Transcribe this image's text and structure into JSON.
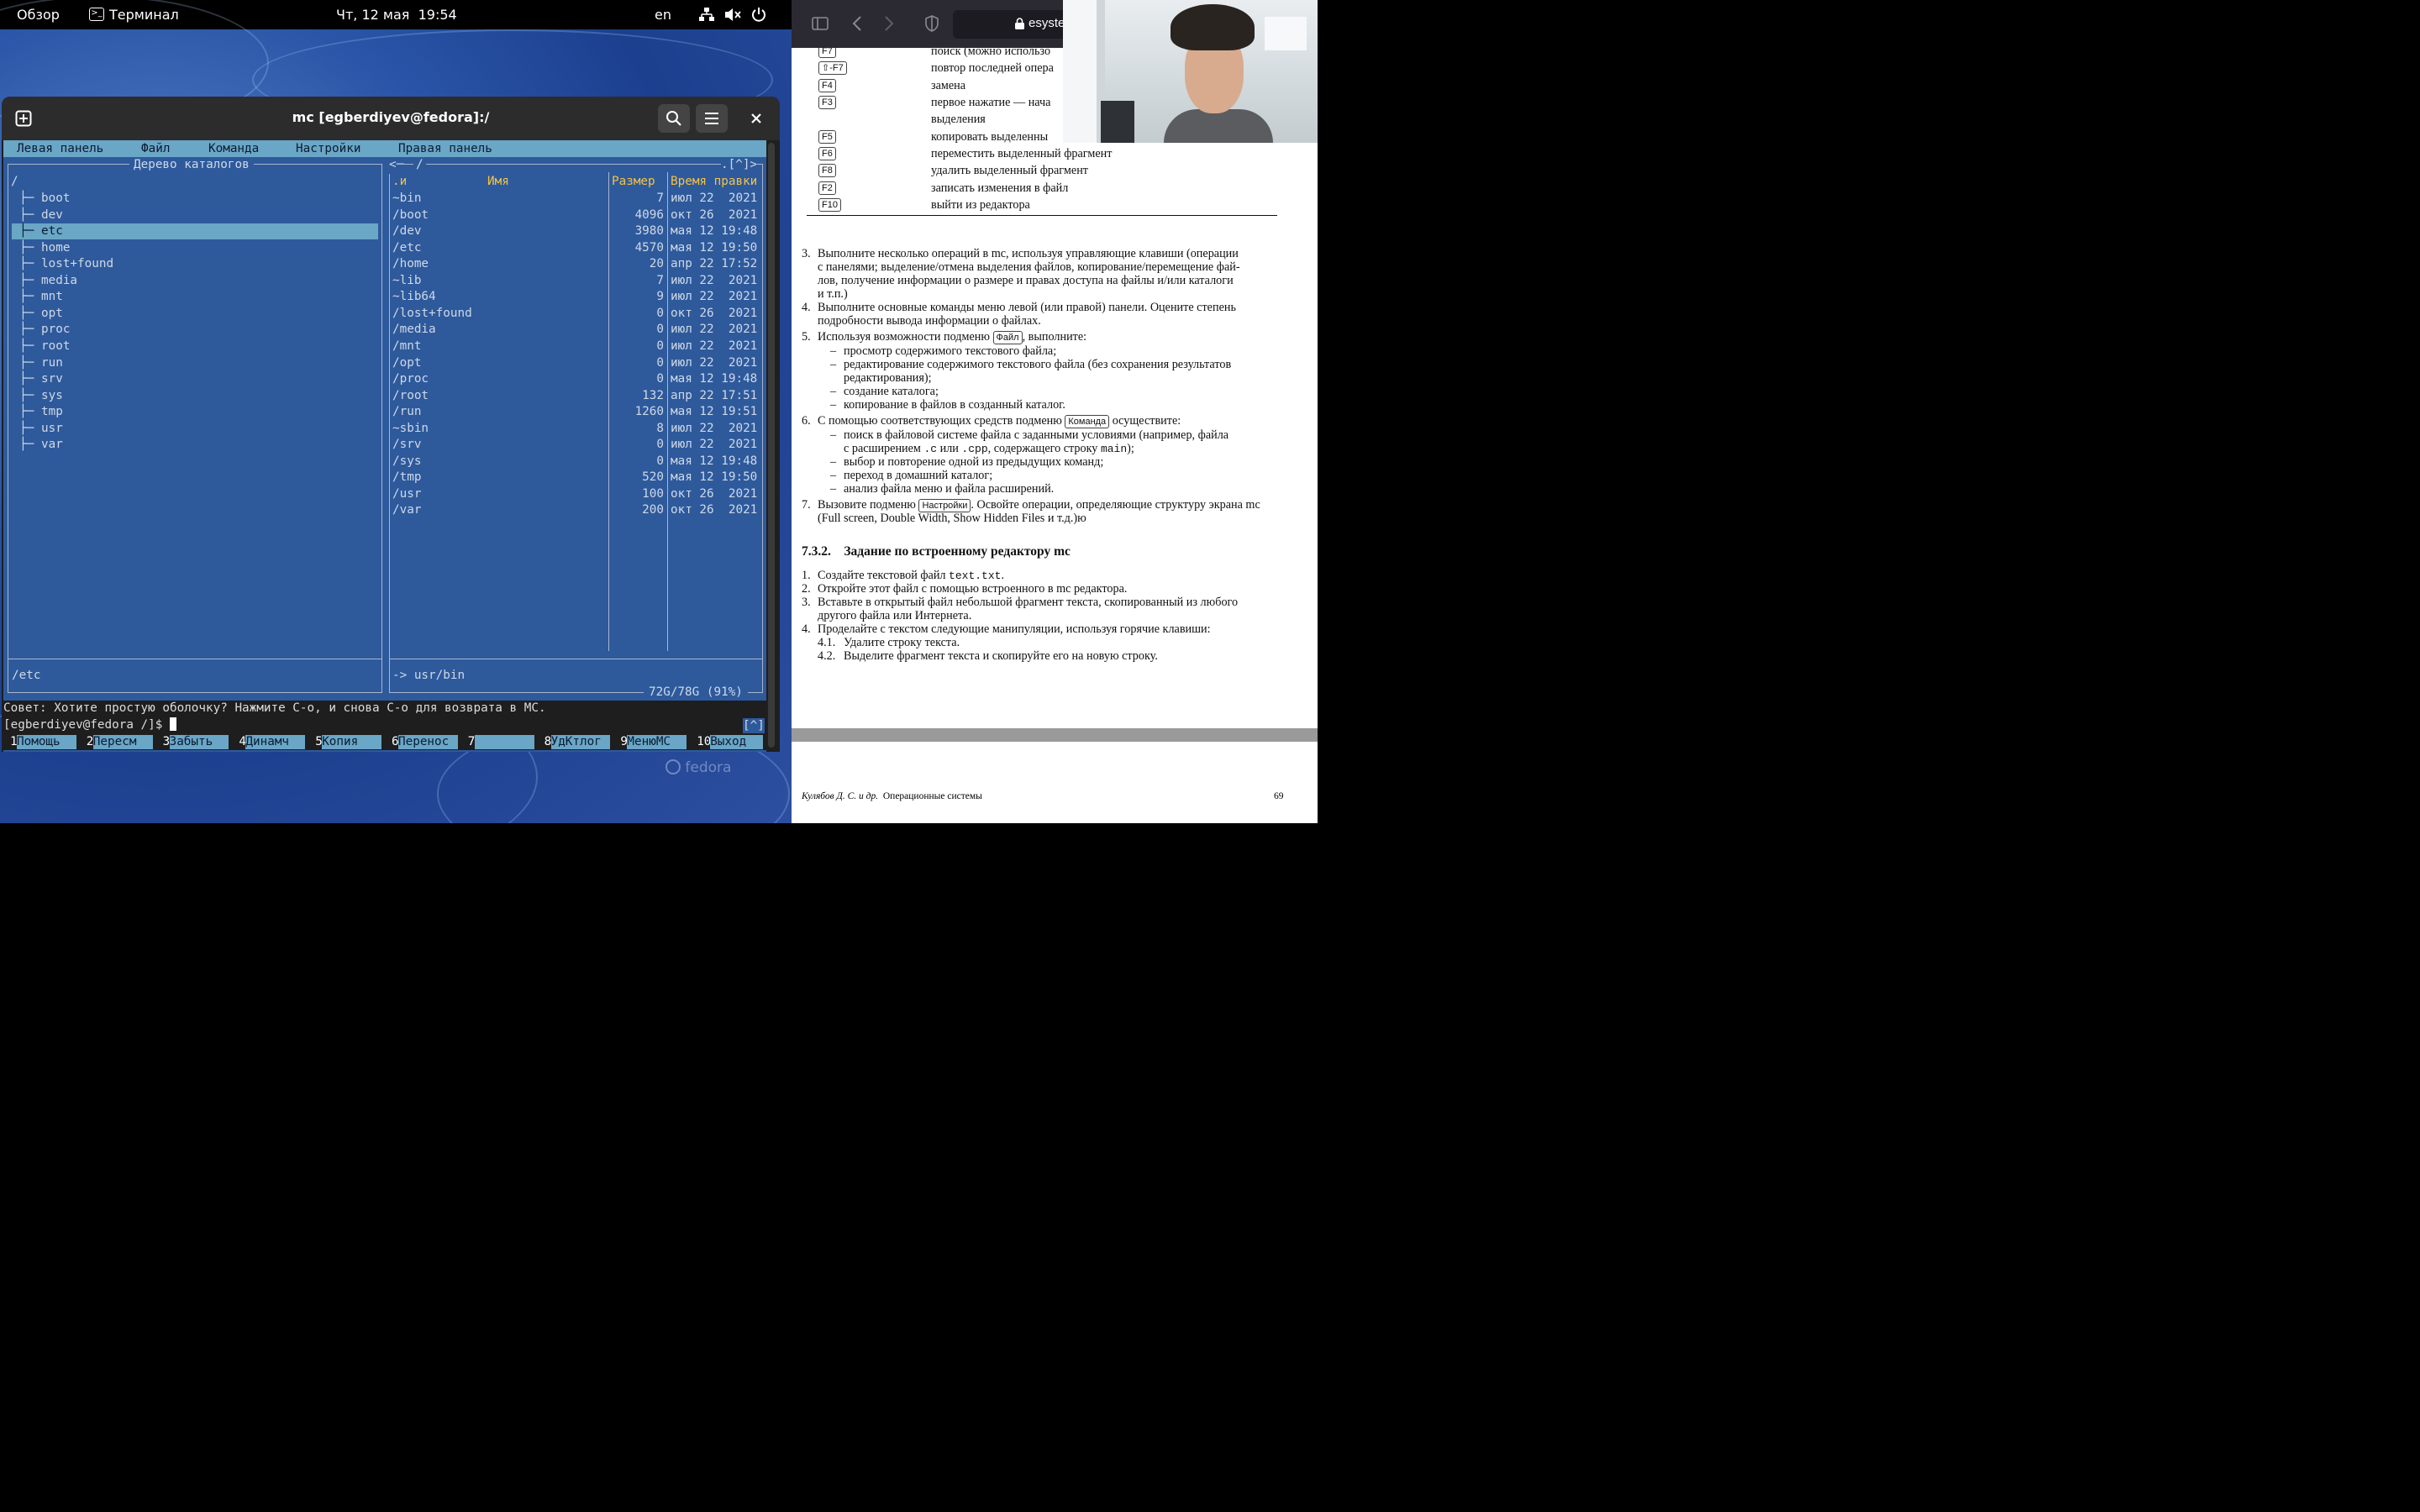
{
  "topbar": {
    "overview": "Обзор",
    "app": "Терминал",
    "clock": "Чт, 12 мая  19:54",
    "lang": "en"
  },
  "window": {
    "title": "mc [egberdiyev@fedora]:/"
  },
  "mc": {
    "menu": [
      "Левая панель",
      "Файл",
      "Команда",
      "Настройки",
      "Правая панель"
    ],
    "left": {
      "title": "Дерево каталогов",
      "root": "/",
      "tree": [
        "boot",
        "dev",
        "etc",
        "home",
        "lost+found",
        "media",
        "mnt",
        "opt",
        "proc",
        "root",
        "run",
        "srv",
        "sys",
        "tmp",
        "usr",
        "var"
      ],
      "selected": "etc",
      "status": "/etc"
    },
    "right": {
      "path": "/",
      "corner": ".[^]>",
      "head": {
        "n": ".и",
        "name": "Имя",
        "size": "Размер",
        "time": "Время правки"
      },
      "rows": [
        {
          "name": "~bin",
          "size": "7",
          "time": "июл 22  2021"
        },
        {
          "name": "/boot",
          "size": "4096",
          "time": "окт 26  2021"
        },
        {
          "name": "/dev",
          "size": "3980",
          "time": "мая 12 19:48"
        },
        {
          "name": "/etc",
          "size": "4570",
          "time": "мая 12 19:50"
        },
        {
          "name": "/home",
          "size": "20",
          "time": "апр 22 17:52"
        },
        {
          "name": "~lib",
          "size": "7",
          "time": "июл 22  2021"
        },
        {
          "name": "~lib64",
          "size": "9",
          "time": "июл 22  2021"
        },
        {
          "name": "/lost+found",
          "size": "0",
          "time": "окт 26  2021"
        },
        {
          "name": "/media",
          "size": "0",
          "time": "июл 22  2021"
        },
        {
          "name": "/mnt",
          "size": "0",
          "time": "июл 22  2021"
        },
        {
          "name": "/opt",
          "size": "0",
          "time": "июл 22  2021"
        },
        {
          "name": "/proc",
          "size": "0",
          "time": "мая 12 19:48"
        },
        {
          "name": "/root",
          "size": "132",
          "time": "апр 22 17:51"
        },
        {
          "name": "/run",
          "size": "1260",
          "time": "мая 12 19:51"
        },
        {
          "name": "~sbin",
          "size": "8",
          "time": "июл 22  2021"
        },
        {
          "name": "/srv",
          "size": "0",
          "time": "июл 22  2021"
        },
        {
          "name": "/sys",
          "size": "0",
          "time": "мая 12 19:48"
        },
        {
          "name": "/tmp",
          "size": "520",
          "time": "мая 12 19:50"
        },
        {
          "name": "/usr",
          "size": "100",
          "time": "окт 26  2021"
        },
        {
          "name": "/var",
          "size": "200",
          "time": "окт 26  2021"
        }
      ],
      "status": "-> usr/bin",
      "disk": "72G/78G (91%)"
    },
    "hint": "Совет: Хотите простую оболочку? Нажмите C-o, и снова C-o для возврата в MC.",
    "prompt": "[egberdiyev@fedora /]$",
    "prompt_tag": "[^]",
    "fkeys": [
      {
        "n": "1",
        "l": "Помощь"
      },
      {
        "n": "2",
        "l": "Пересм"
      },
      {
        "n": "3",
        "l": "Забыть"
      },
      {
        "n": "4",
        "l": "Динамч"
      },
      {
        "n": "5",
        "l": "Копия"
      },
      {
        "n": "6",
        "l": "Перенос"
      },
      {
        "n": "7",
        "l": ""
      },
      {
        "n": "8",
        "l": "УдКтлог"
      },
      {
        "n": "9",
        "l": "МенюMC"
      },
      {
        "n": "10",
        "l": "Выход"
      }
    ]
  },
  "browser": {
    "url": "esyste",
    "desktop_logo": "fedora"
  },
  "doc": {
    "keys": [
      {
        "k": "F7",
        "d": "поиск (можно использо"
      },
      {
        "k": "⇧-F7",
        "d": "повтор последней опера"
      },
      {
        "k": "F4",
        "d": "замена"
      },
      {
        "k": "F3",
        "d": "первое нажатие — нача"
      },
      {
        "k": "",
        "d": "выделения"
      },
      {
        "k": "F5",
        "d": "копировать выделенны"
      },
      {
        "k": "F6",
        "d": "переместить выделенный фрагмент"
      },
      {
        "k": "F8",
        "d": "удалить выделенный фрагмент"
      },
      {
        "k": "F2",
        "d": "записать изменения в файл"
      },
      {
        "k": "F10",
        "d": "выйти из редактора"
      }
    ],
    "items3": [
      "Выполните несколько операций в mc, используя управляющие клавиши (операции",
      "с панелями; выделение/отмена выделения файлов, копирование/перемещение фай-",
      "лов, получение информации о размере и правах доступа на файлы и/или каталоги",
      "и т.п.)"
    ],
    "items4": [
      "Выполните основные команды меню левой (или правой) панели. Оцените степень",
      "подробности вывода информации о файлах."
    ],
    "item5_pre": "Используя возможности подменю ",
    "item5_key": "Файл",
    "item5_post": ", выполните:",
    "sub5": [
      "просмотр содержимого текстового файла;",
      "редактирование содержимого текстового файла (без сохранения результатов",
      "редактирования);",
      "создание каталога;",
      "копирование в файлов в созданный каталог."
    ],
    "item6_pre": "С помощью соответствующих средств подменю ",
    "item6_key": "Команда",
    "item6_post": " осуществите:",
    "sub6a_pre": "поиск в файловой системе файла с заданными условиями (например, файла",
    "sub6a_l2a": "с расширением ",
    "sub6a_c": ".c",
    "sub6a_or": " или ",
    "sub6a_cpp": ".cpp",
    "sub6a_l2b": ", содержащего строку ",
    "sub6a_main": "main",
    "sub6a_end": ");",
    "sub6": [
      "выбор и повторение одной из предыдущих команд;",
      "переход в домашний каталог;",
      "анализ файла меню и файла расширений."
    ],
    "item7_pre": "Вызовите подменю ",
    "item7_key": "Настройки",
    "item7_post": ". Освойте операции, определяющие структуру экрана mc",
    "item7_l2": "(Full screen, Double Width, Show Hidden Files и т.д.)ю",
    "section_num": "7.3.2.",
    "section_title": "Задание по встроенному редактору mc",
    "s1_pre": "Создайте текстовой файл ",
    "s1_code": "text.txt",
    "s1_post": ".",
    "s2": "Откройте этот файл с помощью встроенного в mc редактора.",
    "s3": [
      "Вставьте в открытый файл небольшой фрагмент текста, скопированный из любого",
      "другого файла или Интернета."
    ],
    "s4": "Проделайте с текстом следующие манипуляции, используя горячие клавиши:",
    "s41": "Удалите строку текста.",
    "s42": "Выделите фрагмент текста и скопируйте его на новую строку.",
    "footer_left": "Кулябов Д. С. и др.",
    "footer_mid": "Операционные системы",
    "footer_page": "69"
  }
}
